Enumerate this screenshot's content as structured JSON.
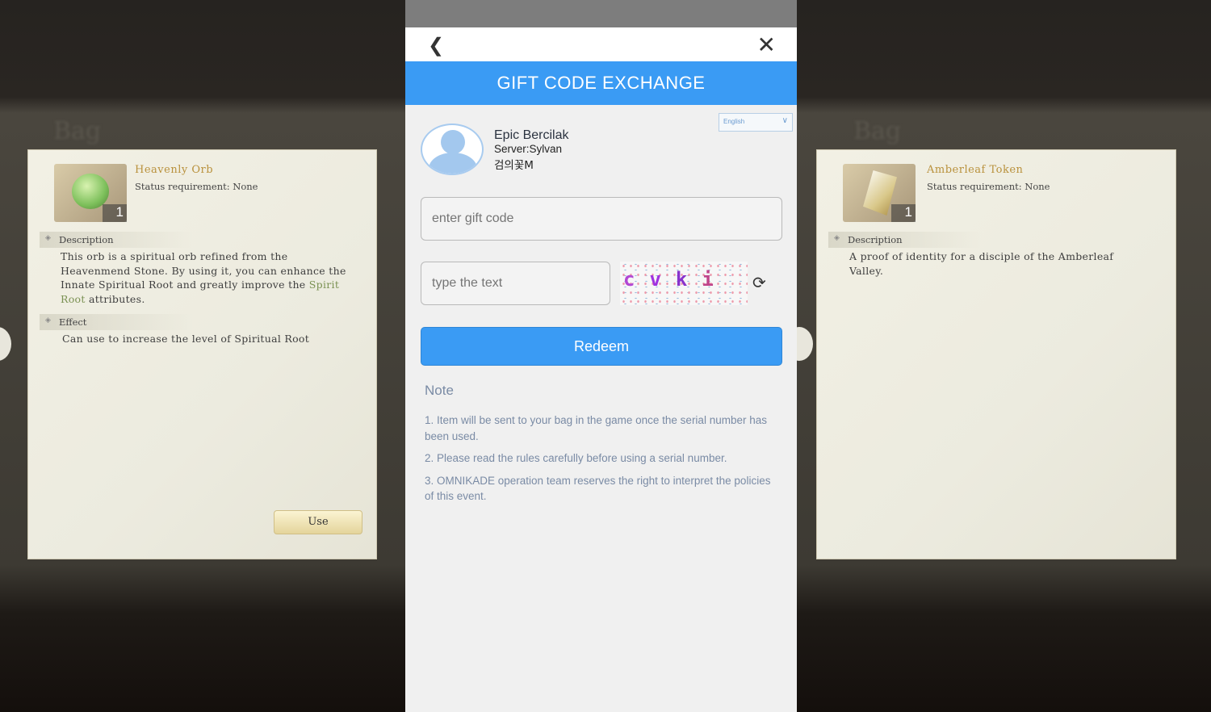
{
  "background": {
    "bag_title": "Bag",
    "left_item": {
      "name": "Heavenly Orb",
      "status": "Status requirement: None",
      "quantity": "1",
      "description_label": "Description",
      "description_pre": "This orb is a spiritual orb refined from the Heavenmend Stone. By using it, you can enhance the Innate Spiritual Root and greatly improve the ",
      "description_highlight": "Spirit Root",
      "description_post": " attributes.",
      "effect_label": "Effect",
      "effect": "Can use to increase the level of Spiritual Root",
      "use_label": "Use"
    },
    "right_item": {
      "name": "Amberleaf Token",
      "status": "Status requirement: None",
      "quantity": "1",
      "description_label": "Description",
      "description": "A proof of identity for a disciple of the Amberleaf Valley."
    }
  },
  "dialog": {
    "back_icon": "chevron-left-icon",
    "close_icon": "close-icon",
    "title": "GIFT CODE EXCHANGE",
    "language": "English",
    "user": {
      "name": "Epic Bercilak",
      "server": "Server:Sylvan",
      "role": "검의꽃M"
    },
    "gift_code_placeholder": "enter gift code",
    "captcha_placeholder": "type the text",
    "captcha_chars": [
      "c",
      "v",
      "k",
      "i"
    ],
    "redeem_label": "Redeem",
    "note_title": "Note",
    "notes": [
      "1. Item will be sent to your bag in the game once the serial number has been used.",
      "2. Please read the rules carefully before using a serial number.",
      "3. OMNIKADE operation team reserves the right to interpret the policies of this event."
    ],
    "colors": {
      "accent": "#3a9bf4",
      "note_text": "#7a8ba5"
    }
  }
}
